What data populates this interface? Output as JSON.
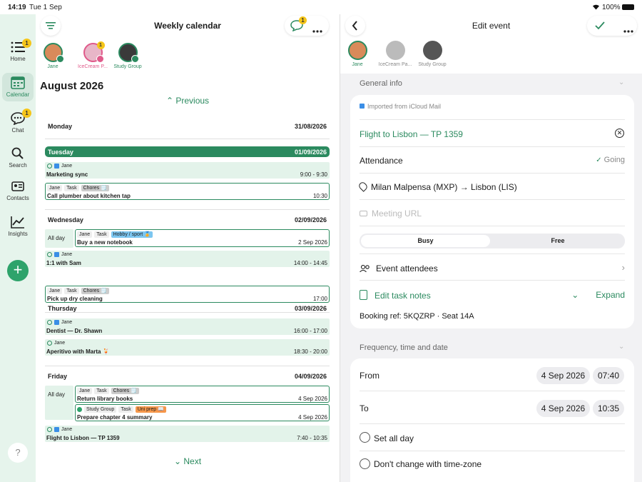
{
  "status": {
    "time": "14:19",
    "date": "Tue 1 Sep",
    "battery": "100%"
  },
  "sidebar": {
    "items": [
      {
        "label": "Home",
        "badge": "1"
      },
      {
        "label": "Calendar"
      },
      {
        "label": "Chat",
        "badge": "1"
      },
      {
        "label": "Search"
      },
      {
        "label": "Contacts"
      },
      {
        "label": "Insights"
      }
    ],
    "help": "?",
    "add": "+"
  },
  "left": {
    "title": "Weekly calendar",
    "chat_badge": "1",
    "avatars": [
      {
        "label": "Jane"
      },
      {
        "label": "IceCream P...",
        "badge": "1"
      },
      {
        "label": "Study Group"
      }
    ],
    "month": "August 2026",
    "previous": "Previous",
    "next": "Next",
    "days": [
      {
        "name": "Monday",
        "date": "31/08/2026"
      },
      {
        "name": "Tuesday",
        "date": "01/09/2026"
      },
      {
        "name": "Wednesday",
        "date": "02/09/2026"
      },
      {
        "name": "Thursday",
        "date": "03/09/2026"
      },
      {
        "name": "Friday",
        "date": "04/09/2026"
      }
    ],
    "allday": "All day",
    "events": {
      "mkt": {
        "who": "Jane",
        "name": "Marketing sync",
        "time": "9:00 - 9:30"
      },
      "plumb": {
        "who": "Jane",
        "type": "Task",
        "tag": "Chores 🗒️",
        "name": "Call plumber about kitchen tap",
        "time": "10:30"
      },
      "note": {
        "who": "Jane",
        "type": "Task",
        "tag": "Hobby / sport 🏅",
        "name": "Buy a new notebook",
        "time": "2 Sep 2026"
      },
      "sam": {
        "who": "Jane",
        "name": "1:1 with Sam",
        "time": "14:00 - 14:45"
      },
      "dry": {
        "who": "Jane",
        "type": "Task",
        "tag": "Chores 🗒️",
        "name": "Pick up dry cleaning",
        "time": "17:00"
      },
      "dent": {
        "who": "Jane",
        "name": "Dentist — Dr. Shawn",
        "time": "16:00 - 17:00"
      },
      "aper": {
        "who": "Jane",
        "name": "Aperitivo with Marta 🍹",
        "time": "18:30 - 20:00"
      },
      "lib": {
        "who": "Jane",
        "type": "Task",
        "tag": "Chores 🗒️",
        "name": "Return library books",
        "time": "4 Sep 2026"
      },
      "chap": {
        "who": "Study Group",
        "type": "Task",
        "tag": "Uni prep 📖",
        "name": "Prepare chapter 4 summary",
        "time": "4 Sep 2026"
      },
      "fl": {
        "who": "Jane",
        "name": "Flight to Lisbon — TP 1359",
        "time": "7:40 - 10:35"
      }
    }
  },
  "right": {
    "title": "Edit event",
    "avatars": [
      {
        "label": "Jane"
      },
      {
        "label": "IceCream Pa..."
      },
      {
        "label": "Study Group"
      }
    ],
    "section1": "General info",
    "imported": "Imported from iCloud Mail",
    "event_title": "Flight to Lisbon — TP 1359",
    "attendance_label": "Attendance",
    "attendance_value": "Going",
    "location": "Milan Malpensa (MXP) → Lisbon (LIS)",
    "meeting_placeholder": "Meeting URL",
    "busy": "Busy",
    "free": "Free",
    "attendees": "Event attendees",
    "notes": "Edit task notes",
    "expand": "Expand",
    "notes_text": "Booking ref: 5KQZRP · Seat 14A",
    "section2": "Frequency, time and date",
    "from_label": "From",
    "from_date": "4 Sep 2026",
    "from_time": "07:40",
    "to_label": "To",
    "to_date": "4 Sep 2026",
    "to_time": "10:35",
    "allday": "Set all day",
    "tz": "Don't change with time-zone"
  },
  "colors": {
    "accent": "#2b8a5f",
    "sidebar": "#e6f4ec",
    "badge": "#f5c518"
  }
}
